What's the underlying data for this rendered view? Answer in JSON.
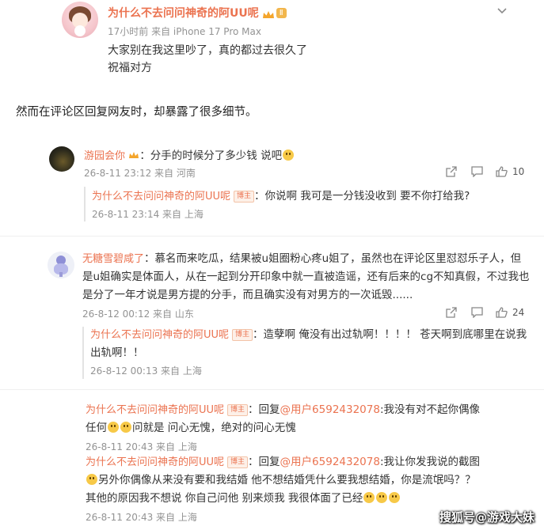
{
  "post": {
    "author": "为什么不去问问神奇的阿UU呢",
    "meta": "17小时前 来自 iPhone 17 Pro Max",
    "line1": "大家别在我这里吵了，真的都过去很久了",
    "line2": "祝福对方",
    "level_badge": "Ⅱ"
  },
  "caption": "然而在评论区回复网友时，却暴露了很多细节。",
  "badge_label": "博主",
  "c1": {
    "user": "游园会你",
    "text": "：分手的时候分了多少钱 说吧",
    "meta": "26-8-11 23:12 来自 河南",
    "likes": "10",
    "reply": {
      "user": "为什么不去问问神奇的阿UU呢",
      "text": "：你说啊 我可是一分钱没收到 要不你打给我?",
      "meta": "26-8-11 23:14 来自 上海"
    }
  },
  "c2": {
    "user": "无糖雪碧咸了",
    "line1": "：慕名而来吃瓜，结果被u姐圈粉心疼u姐了，虽然也在评论区里怼怼乐子人，但",
    "line2": "是u姐确实是体面人，从在一起到分开印象中就一直被造谣，还有后来的cg不知真假，不过我也",
    "line3": "是分了一年才说是男方提的分手，而且确实没有对男方的一次诋毁......",
    "meta": "26-8-12 00:12 来自 山东",
    "likes": "24",
    "reply": {
      "user": "为什么不去问问神奇的阿UU呢",
      "text1": "：造孽啊 俺没有出过轨啊！！！！ 苍天啊到底哪里在说我",
      "text2": "出轨啊！！",
      "meta": "26-8-12 00:13 来自 上海"
    }
  },
  "r3": {
    "user": "为什么不去问问神奇的阿UU呢",
    "reply_word": "：回复",
    "mention": "@用户6592432078",
    "text1": ":我没有对不起你偶像",
    "text2a": "任何",
    "text2b": "问就是 问心无愧，绝对的问心无愧",
    "meta": "26-8-11 20:43 来自 上海"
  },
  "r4": {
    "user": "为什么不去问问神奇的阿UU呢",
    "reply_word": "：回复",
    "mention": "@用户6592432078",
    "text1": ":我让你发我说的截图",
    "text2": "另外你偶像从来没有要和我结婚 他不想结婚凭什么要我想结婚，你是流氓吗？？",
    "text3": "其他的原因我不想说 你自己问他 别来烦我 我很体面了已经",
    "meta": "26-8-11 20:43 来自 上海"
  },
  "watermark": "搜狐号@游戏大妹"
}
